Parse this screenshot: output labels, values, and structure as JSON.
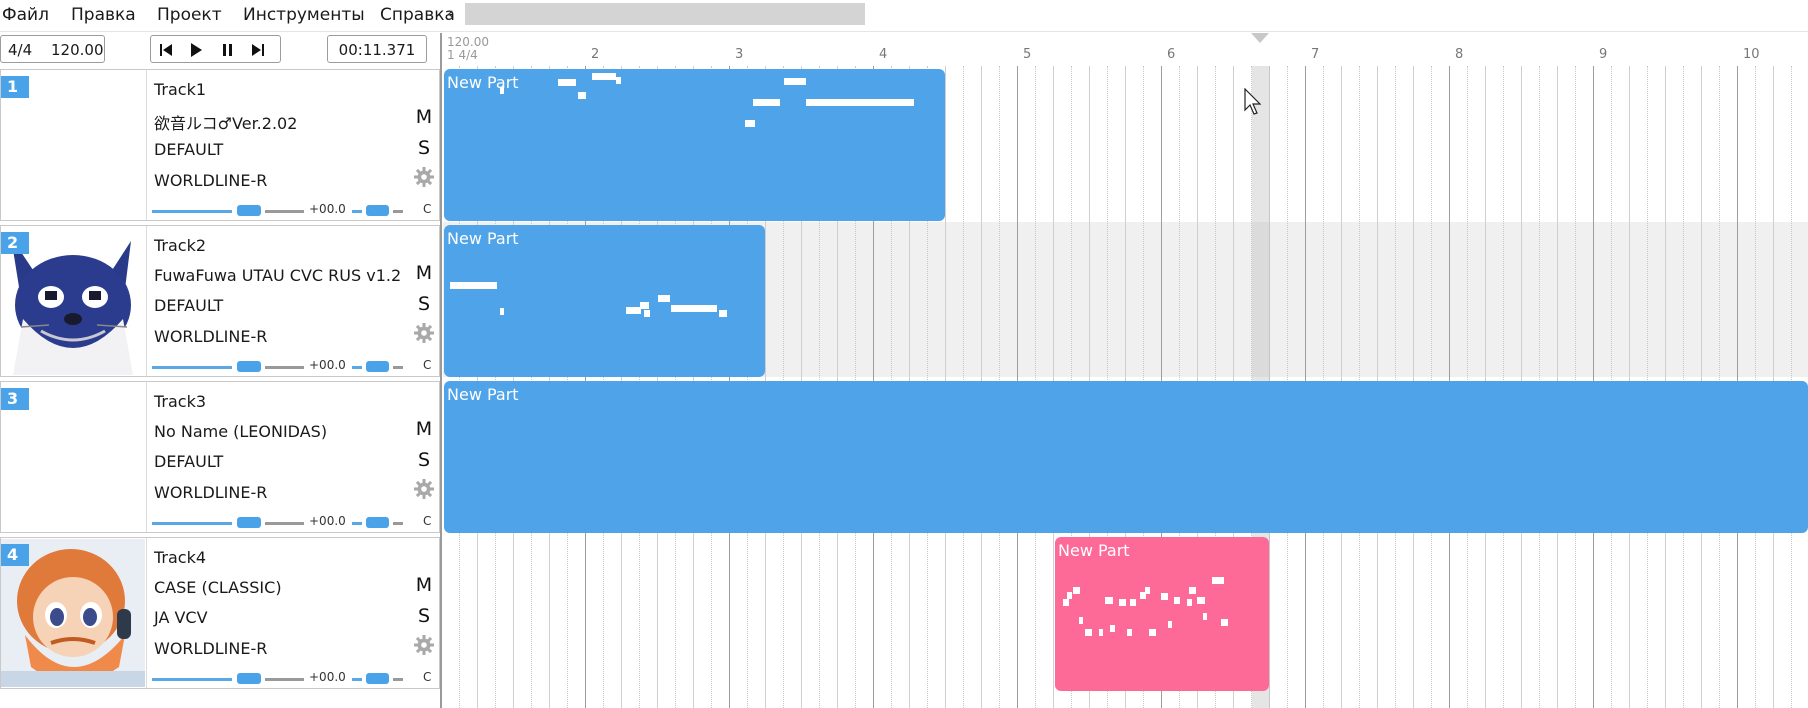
{
  "menu": {
    "items": [
      "Файл",
      "Правка",
      "Проект",
      "Инструменты",
      "Справка"
    ],
    "overflow_glyph": "‹"
  },
  "toolbar": {
    "time_signature": "4/4",
    "tempo": "120.00",
    "clock": "00:11.371",
    "transport_icons": [
      "skip-back-icon",
      "play-icon",
      "pause-icon",
      "skip-forward-icon"
    ]
  },
  "ruler": {
    "tempo_marker": "120.00",
    "signature_marker": "1 4/4",
    "bars": [
      "2",
      "3",
      "4",
      "5",
      "6",
      "7",
      "8",
      "9",
      "10"
    ]
  },
  "tracks": [
    {
      "number": "1",
      "name": "Track1",
      "singer": "欲音ルコ♂Ver.2.02",
      "phonemizer": "DEFAULT",
      "renderer": "WORLDLINE-R",
      "mute": "M",
      "solo": "S",
      "volume": "+00.0",
      "pan": "C",
      "avatar": "none"
    },
    {
      "number": "2",
      "name": "Track2",
      "singer": "FuwaFuwa UTAU CVC RUS v1.2",
      "phonemizer": "DEFAULT",
      "renderer": "WORLDLINE-R",
      "mute": "M",
      "solo": "S",
      "volume": "+00.0",
      "pan": "C",
      "avatar": "cat-avatar"
    },
    {
      "number": "3",
      "name": "Track3",
      "singer": "No Name (LEONIDAS)",
      "phonemizer": "DEFAULT",
      "renderer": "WORLDLINE-R",
      "mute": "M",
      "solo": "S",
      "volume": "+00.0",
      "pan": "C",
      "avatar": "none"
    },
    {
      "number": "4",
      "name": "Track4",
      "singer": "CASE (CLASSIC)",
      "phonemizer": "JA VCV",
      "renderer": "WORLDLINE-R",
      "mute": "M",
      "solo": "S",
      "volume": "+00.0",
      "pan": "C",
      "avatar": "bearded-character-avatar"
    }
  ],
  "parts": [
    {
      "track": 1,
      "title": "New Part",
      "color": "#4fa3e8",
      "start_bar": 1,
      "end_bar": 4.5
    },
    {
      "track": 2,
      "title": "New Part",
      "color": "#4fa3e8",
      "start_bar": 1,
      "end_bar": 3.25
    },
    {
      "track": 3,
      "title": "New Part",
      "color": "#4fa3e8",
      "start_bar": 1,
      "end_bar": 10.5
    },
    {
      "track": 4,
      "title": "New Part",
      "color": "#fd6a98",
      "start_bar": 5.25,
      "end_bar": 6.75
    }
  ],
  "colors": {
    "accent": "#4aa3e8",
    "part_blue": "#4fa3e8",
    "part_pink": "#fd6a98"
  }
}
